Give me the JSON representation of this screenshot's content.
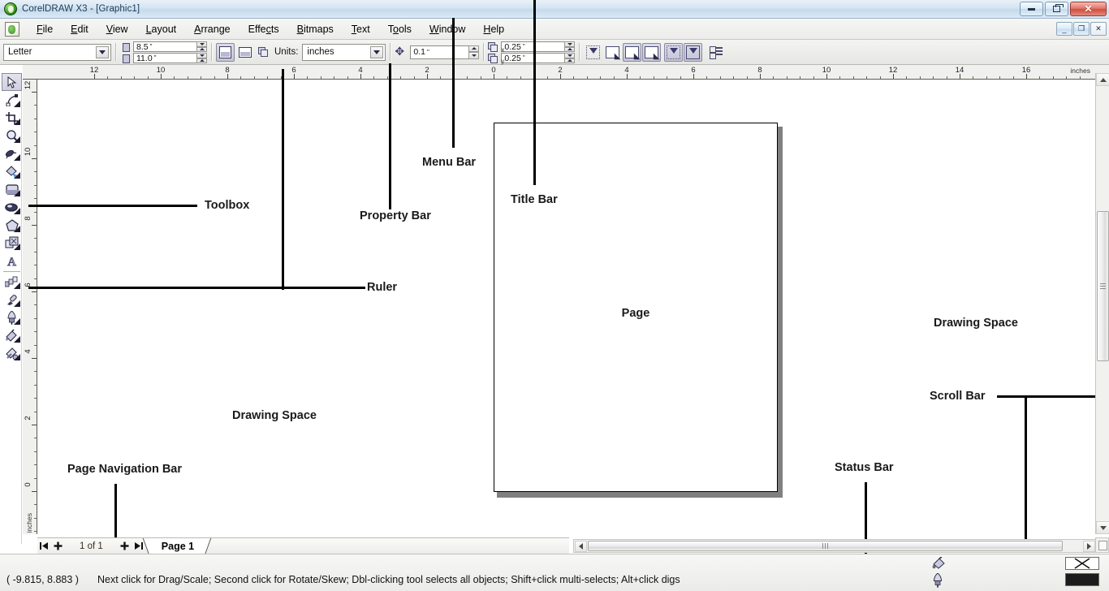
{
  "window": {
    "title": "CorelDRAW X3 - [Graphic1]",
    "app_icon": "coreldraw-balloon-icon",
    "controls": {
      "minimize": "minimize-icon",
      "restore": "restore-icon",
      "close": "close-icon"
    },
    "mdi_controls": {
      "minimize": "_",
      "restore": "restore-icon",
      "close": "✕"
    },
    "titlebar_color": "#c6daec"
  },
  "menu": {
    "doc_icon": "document-icon",
    "items": [
      {
        "label": "File",
        "mnemonic": "F"
      },
      {
        "label": "Edit",
        "mnemonic": "E"
      },
      {
        "label": "View",
        "mnemonic": "V"
      },
      {
        "label": "Layout",
        "mnemonic": "L"
      },
      {
        "label": "Arrange",
        "mnemonic": "A"
      },
      {
        "label": "Effects",
        "mnemonic": "c"
      },
      {
        "label": "Bitmaps",
        "mnemonic": "B"
      },
      {
        "label": "Text",
        "mnemonic": "T"
      },
      {
        "label": "Tools",
        "mnemonic": "o"
      },
      {
        "label": "Window",
        "mnemonic": "W"
      },
      {
        "label": "Help",
        "mnemonic": "H"
      }
    ]
  },
  "property_bar": {
    "paper_type": "Letter",
    "paper_width": "8.5",
    "paper_height": "11.0",
    "unit_mark": "\"",
    "orientation_portrait": "portrait-icon",
    "orientation_landscape": "landscape-icon",
    "page_setup_icon": "page-setup-icon",
    "units_label": "Units:",
    "units_value": "inches",
    "nudge_icon": "nudge-offset-icon",
    "nudge_value": "0.1",
    "duplicate_x_label": "x",
    "duplicate_x": "0.25",
    "duplicate_y_label": "y",
    "duplicate_y": "0.25",
    "buttons": [
      {
        "name": "snap-to-grid-button",
        "pressed": false
      },
      {
        "name": "snap-to-guidelines-button",
        "pressed": false
      },
      {
        "name": "snap-to-objects-button",
        "pressed": true
      },
      {
        "name": "dynamic-guides-button",
        "pressed": true
      },
      {
        "name": "treat-as-filled-button",
        "pressed": true
      },
      {
        "name": "marquee-select-button",
        "pressed": true
      },
      {
        "name": "options-button",
        "pressed": false
      }
    ]
  },
  "rulers": {
    "horizontal_ticks": [
      "12",
      "10",
      "8",
      "6",
      "4",
      "2",
      "0",
      "2",
      "4",
      "6",
      "8",
      "10",
      "12",
      "14",
      "16"
    ],
    "vertical_ticks": [
      "12",
      "10",
      "8",
      "6",
      "4",
      "2",
      "0"
    ],
    "unit_label": "inches"
  },
  "toolbox": {
    "tools": [
      {
        "name": "pick-tool",
        "active": true,
        "flyout": false
      },
      {
        "name": "shape-tool",
        "active": false,
        "flyout": true
      },
      {
        "name": "crop-tool",
        "active": false,
        "flyout": true
      },
      {
        "name": "zoom-tool",
        "active": false,
        "flyout": true
      },
      {
        "name": "freehand-tool",
        "active": false,
        "flyout": true
      },
      {
        "name": "smart-fill-tool",
        "active": false,
        "flyout": true
      },
      {
        "name": "rectangle-tool",
        "active": false,
        "flyout": true
      },
      {
        "name": "ellipse-tool",
        "active": false,
        "flyout": true
      },
      {
        "name": "polygon-tool",
        "active": false,
        "flyout": true
      },
      {
        "name": "basic-shapes-tool",
        "active": false,
        "flyout": true
      },
      {
        "name": "text-tool",
        "active": false,
        "flyout": false
      },
      {
        "name": "blend-tool",
        "active": false,
        "flyout": true
      },
      {
        "name": "eyedropper-tool",
        "active": false,
        "flyout": true
      },
      {
        "name": "outline-tool",
        "active": false,
        "flyout": true
      },
      {
        "name": "fill-tool",
        "active": false,
        "flyout": true
      },
      {
        "name": "interactive-fill-tool",
        "active": false,
        "flyout": true
      }
    ]
  },
  "canvas": {
    "page_label": "Page",
    "page_border_color": "#000000",
    "page_shadow_color": "#808080"
  },
  "annotations": [
    {
      "label": "Menu Bar",
      "name": "annotation-menu-bar"
    },
    {
      "label": "Title Bar",
      "name": "annotation-title-bar"
    },
    {
      "label": "Toolbox",
      "name": "annotation-toolbox"
    },
    {
      "label": "Property Bar",
      "name": "annotation-property-bar"
    },
    {
      "label": "Ruler",
      "name": "annotation-ruler"
    },
    {
      "label": "Drawing Space",
      "name": "annotation-drawing-space-left"
    },
    {
      "label": "Drawing Space",
      "name": "annotation-drawing-space-right"
    },
    {
      "label": "Scroll Bar",
      "name": "annotation-scroll-bar"
    },
    {
      "label": "Status Bar",
      "name": "annotation-status-bar"
    },
    {
      "label": "Page Navigation Bar",
      "name": "annotation-page-navigation-bar"
    }
  ],
  "page_nav": {
    "first_page_icon": "first-page-icon",
    "add_page_before_icon": "plus-icon",
    "counter": "1 of 1",
    "add_page_after_icon": "plus-icon",
    "last_page_icon": "last-page-icon",
    "tab_label": "Page 1"
  },
  "scrollbars": {
    "vertical": {
      "up": "scroll-up-arrow",
      "down": "scroll-down-arrow"
    },
    "horizontal": {
      "left": "scroll-left-arrow",
      "right": "scroll-right-arrow"
    }
  },
  "status_bar": {
    "coordinates": "( -9.815, 8.883 )",
    "hint": "Next click for Drag/Scale; Second click for Rotate/Skew; Dbl-clicking tool selects all objects; Shift+click multi-selects; Alt+click digs",
    "fill_icon": "fill-bucket-icon",
    "outline_icon": "outline-pen-icon",
    "fill_swatch": "none",
    "fill_swatch_color": "#ffffff",
    "outline_swatch_color": "#1c1c1c"
  }
}
